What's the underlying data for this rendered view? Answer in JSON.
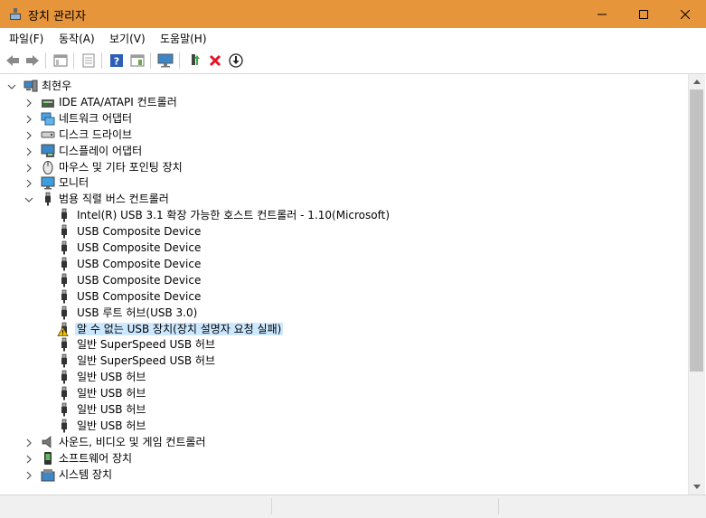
{
  "window": {
    "title": "장치 관리자"
  },
  "menu": [
    {
      "label": "파일(F)"
    },
    {
      "label": "동작(A)"
    },
    {
      "label": "보기(V)"
    },
    {
      "label": "도움말(H)"
    }
  ],
  "tree": {
    "root": "최현우",
    "categories_top": [
      {
        "label": "IDE ATA/ATAPI 컨트롤러",
        "icon": "ide-controller-icon"
      },
      {
        "label": "네트워크 어댑터",
        "icon": "network-adapter-icon"
      },
      {
        "label": "디스크 드라이브",
        "icon": "disk-drive-icon"
      },
      {
        "label": "디스플레이 어댑터",
        "icon": "display-adapter-icon"
      },
      {
        "label": "마우스 및 기타 포인팅 장치",
        "icon": "mouse-icon"
      },
      {
        "label": "모니터",
        "icon": "monitor-icon"
      },
      {
        "label": "범용 직렬 버스 컨트롤러",
        "icon": "usb-icon",
        "expanded": true
      }
    ],
    "usb_children": [
      {
        "label": "Intel(R) USB 3.1 확장 가능한 호스트 컨트롤러 - 1.10(Microsoft)",
        "icon": "usb-device-icon"
      },
      {
        "label": "USB Composite Device",
        "icon": "usb-device-icon"
      },
      {
        "label": "USB Composite Device",
        "icon": "usb-device-icon"
      },
      {
        "label": "USB Composite Device",
        "icon": "usb-device-icon"
      },
      {
        "label": "USB Composite Device",
        "icon": "usb-device-icon"
      },
      {
        "label": "USB Composite Device",
        "icon": "usb-device-icon"
      },
      {
        "label": "USB 루트 허브(USB 3.0)",
        "icon": "usb-device-icon"
      },
      {
        "label": "알 수 없는 USB 장치(장치 설명자 요청 실패)",
        "icon": "warning-icon",
        "selected": true
      },
      {
        "label": "일반 SuperSpeed USB 허브",
        "icon": "usb-device-icon"
      },
      {
        "label": "일반 SuperSpeed USB 허브",
        "icon": "usb-device-icon"
      },
      {
        "label": "일반 USB 허브",
        "icon": "usb-device-icon"
      },
      {
        "label": "일반 USB 허브",
        "icon": "usb-device-icon"
      },
      {
        "label": "일반 USB 허브",
        "icon": "usb-device-icon"
      },
      {
        "label": "일반 USB 허브",
        "icon": "usb-device-icon"
      }
    ],
    "categories_bottom": [
      {
        "label": "사운드, 비디오 및 게임 컨트롤러",
        "icon": "speaker-icon"
      },
      {
        "label": "소프트웨어 장치",
        "icon": "software-device-icon"
      },
      {
        "label": "시스템 장치",
        "icon": "system-device-icon"
      }
    ]
  },
  "colors": {
    "titlebar": "#e6953a",
    "selection": "#cce8ff",
    "error_red": "#e81123",
    "scroll_thumb": "#c2c2c2"
  }
}
